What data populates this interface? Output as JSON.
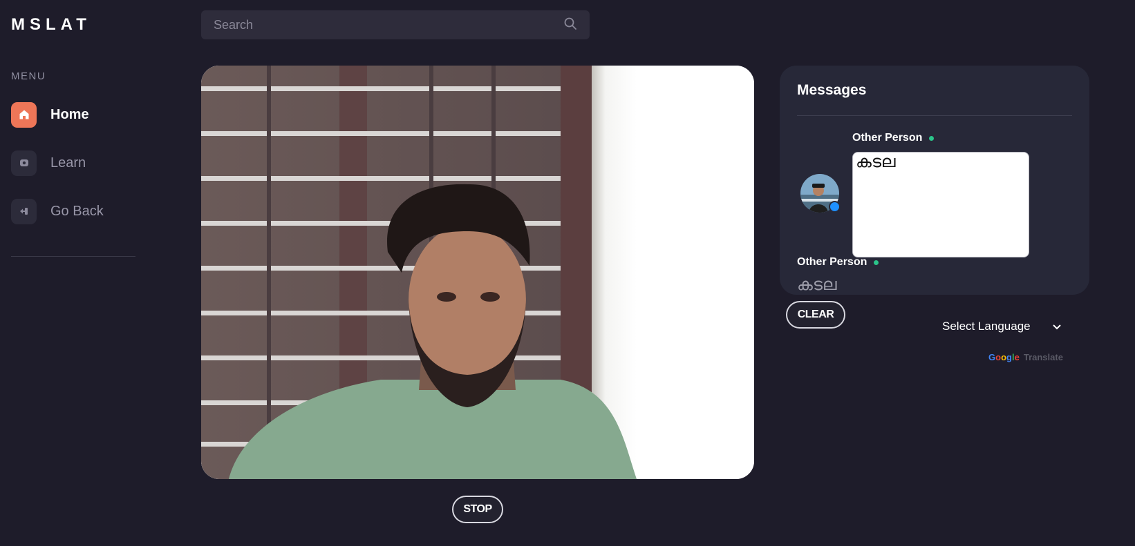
{
  "app": {
    "logo": "MSLAT"
  },
  "sidebar": {
    "menu_title": "MENU",
    "items": [
      {
        "label": "Home",
        "icon": "home-icon",
        "active": true
      },
      {
        "label": "Learn",
        "icon": "learn-icon",
        "active": false
      },
      {
        "label": "Go Back",
        "icon": "go-back-icon",
        "active": false
      }
    ]
  },
  "search": {
    "placeholder": "Search",
    "value": "",
    "icon": "search-icon"
  },
  "video": {
    "stop_label": "STOP"
  },
  "messages": {
    "title": "Messages",
    "items": [
      {
        "sender": "Other Person",
        "text": "കടല",
        "editable": true
      },
      {
        "sender": "Other Person",
        "text": "കടല",
        "editable": false
      }
    ],
    "clear_label": "CLEAR"
  },
  "translate": {
    "select_label": "Select Language",
    "powered_google": "Google",
    "powered_translate": "Translate"
  },
  "colors": {
    "background": "#1e1c2a",
    "accent": "#ee7658",
    "panel": "#272838",
    "online": "#2bc48a",
    "status": "#1e90ff"
  }
}
